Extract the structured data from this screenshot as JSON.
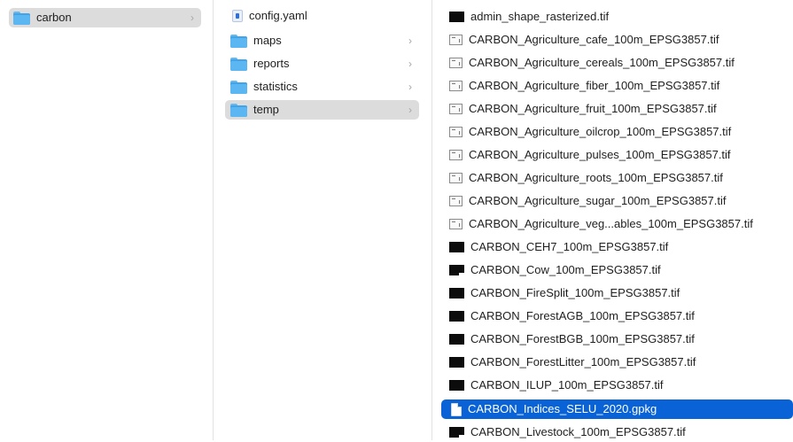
{
  "column1": {
    "items": [
      {
        "label": "carbon",
        "icon": "folder-icon",
        "chevron": "›",
        "selected": "gray"
      }
    ]
  },
  "column2": {
    "items": [
      {
        "label": "config.yaml",
        "icon": "yaml-file-icon",
        "chevron": ""
      },
      {
        "label": "maps",
        "icon": "folder-icon",
        "chevron": "›"
      },
      {
        "label": "reports",
        "icon": "folder-icon",
        "chevron": "›"
      },
      {
        "label": "statistics",
        "icon": "folder-icon",
        "chevron": "›"
      },
      {
        "label": "temp",
        "icon": "folder-icon",
        "chevron": "›",
        "selected": "gray"
      }
    ]
  },
  "column3": {
    "items": [
      {
        "label": "admin_shape_rasterized.tif",
        "icon": "dark-tif-icon"
      },
      {
        "label": "CARBON_Agriculture_cafe_100m_EPSG3857.tif",
        "icon": "light-tif-icon"
      },
      {
        "label": "CARBON_Agriculture_cereals_100m_EPSG3857.tif",
        "icon": "light-tif-icon"
      },
      {
        "label": "CARBON_Agriculture_fiber_100m_EPSG3857.tif",
        "icon": "light-tif-icon"
      },
      {
        "label": "CARBON_Agriculture_fruit_100m_EPSG3857.tif",
        "icon": "light-tif-icon"
      },
      {
        "label": "CARBON_Agriculture_oilcrop_100m_EPSG3857.tif",
        "icon": "light-tif-icon"
      },
      {
        "label": "CARBON_Agriculture_pulses_100m_EPSG3857.tif",
        "icon": "light-tif-icon"
      },
      {
        "label": "CARBON_Agriculture_roots_100m_EPSG3857.tif",
        "icon": "light-tif-icon"
      },
      {
        "label": "CARBON_Agriculture_sugar_100m_EPSG3857.tif",
        "icon": "light-tif-icon"
      },
      {
        "label": "CARBON_Agriculture_veg...ables_100m_EPSG3857.tif",
        "icon": "light-tif-icon"
      },
      {
        "label": "CARBON_CEH7_100m_EPSG3857.tif",
        "icon": "dark-tif-icon"
      },
      {
        "label": "CARBON_Cow_100m_EPSG3857.tif",
        "icon": "cow-tif-icon"
      },
      {
        "label": "CARBON_FireSplit_100m_EPSG3857.tif",
        "icon": "dark-tif-icon"
      },
      {
        "label": "CARBON_ForestAGB_100m_EPSG3857.tif",
        "icon": "dark-tif-icon"
      },
      {
        "label": "CARBON_ForestBGB_100m_EPSG3857.tif",
        "icon": "dark-tif-icon"
      },
      {
        "label": "CARBON_ForestLitter_100m_EPSG3857.tif",
        "icon": "dark-tif-icon"
      },
      {
        "label": "CARBON_ILUP_100m_EPSG3857.tif",
        "icon": "dark-tif-icon"
      },
      {
        "label": "CARBON_Indices_SELU_2020.gpkg",
        "icon": "gpkg-document-icon",
        "selected": "blue"
      },
      {
        "label": "CARBON_Livestock_100m_EPSG3857.tif",
        "icon": "cow-tif-icon"
      }
    ]
  }
}
